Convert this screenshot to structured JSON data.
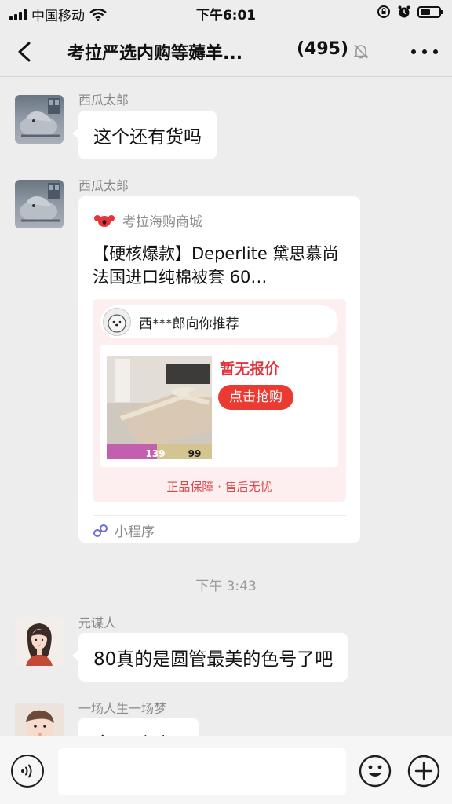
{
  "status_bar": {
    "carrier": "中国移动",
    "time": "下午6:01"
  },
  "nav": {
    "title": "考拉严选内购等薅羊...",
    "member_count": "(495)"
  },
  "messages": [
    {
      "sender": "西瓜太郎",
      "text": "这个还有货吗"
    },
    {
      "sender": "西瓜太郎"
    },
    {
      "sender": "元谋人",
      "text": "80真的是圆管最美的色号了吧"
    },
    {
      "sender": "一场人生一场梦",
      "text": "今天刚到了"
    }
  ],
  "card": {
    "source": "考拉海购商城",
    "title": "【硬核爆款】Deperlite 黛思慕尚 法国进口纯棉被套 60…",
    "recommend_text": "西***郎向你推荐",
    "price_text": "暂无报价",
    "buy_label": "点击抢购",
    "price_a": "139",
    "price_b": "99",
    "guarantee": "正品保障 · 售后无忧",
    "footer": "小程序"
  },
  "timestamp": "下午 3:43",
  "input": {
    "placeholder": ""
  },
  "colors": {
    "background": "#ededed",
    "bubble": "#ffffff",
    "price_red": "#e3343c",
    "buy_button": "#ea3b32"
  }
}
